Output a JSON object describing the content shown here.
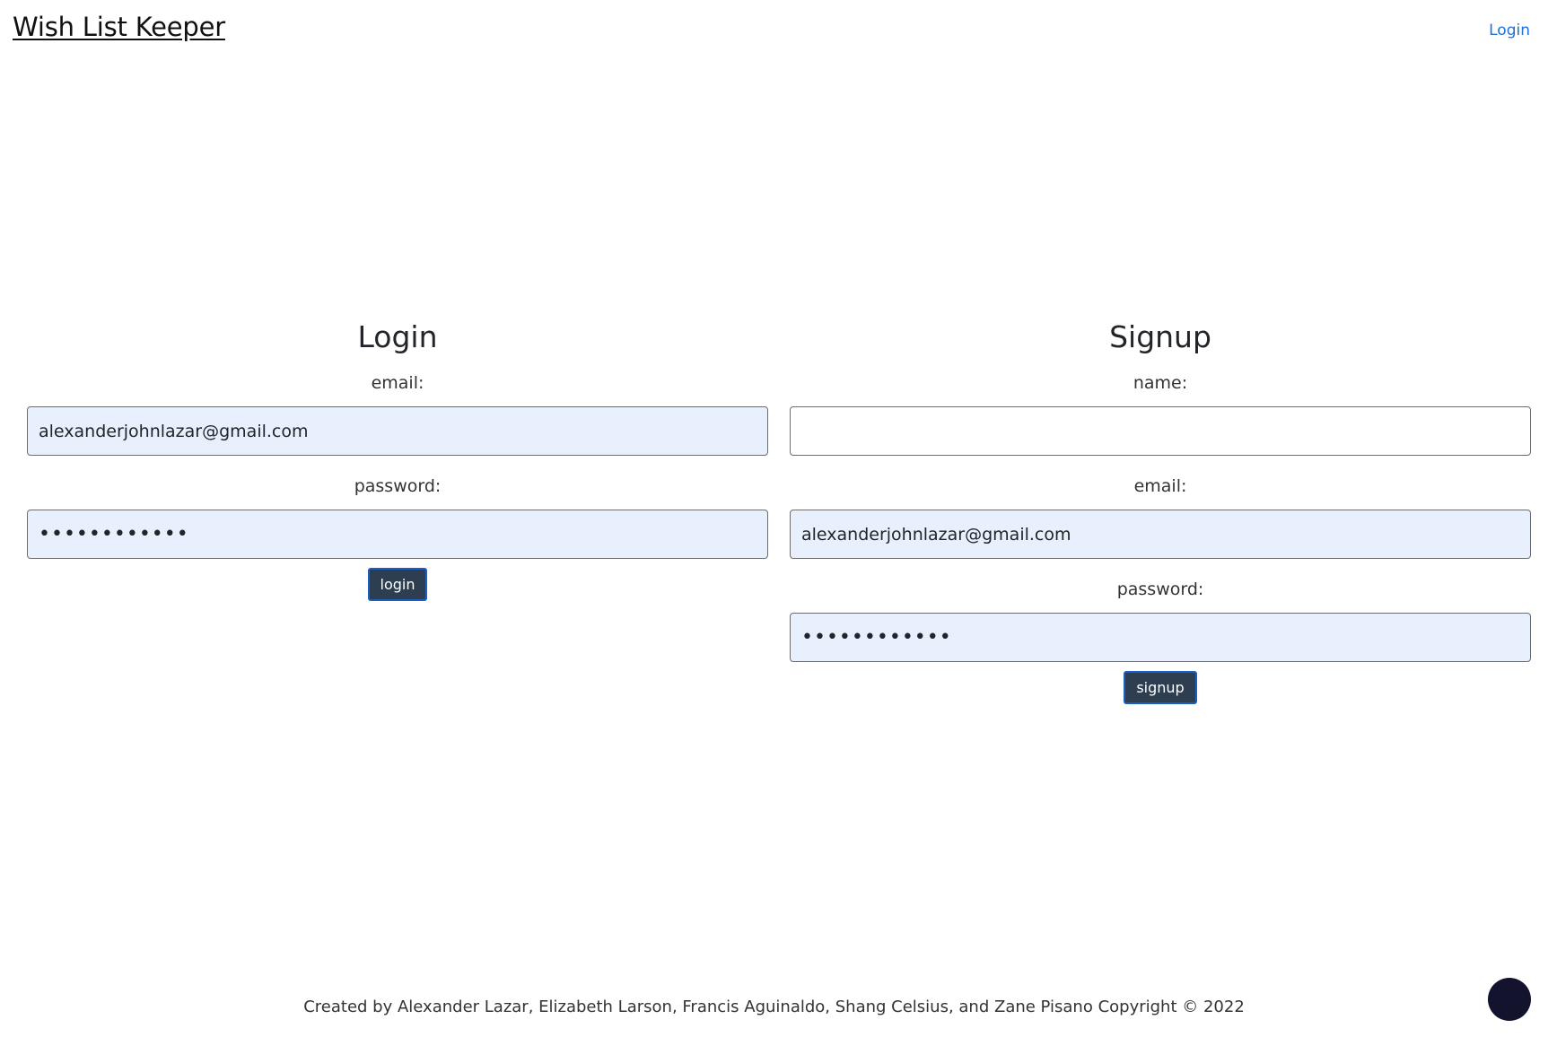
{
  "header": {
    "brand": "Wish List Keeper",
    "nav_login": "Login"
  },
  "login_form": {
    "title": "Login",
    "email_label": "email:",
    "email_value": "alexanderjohnlazar@gmail.com",
    "password_label": "password:",
    "password_value": "••••••••••••",
    "submit_label": "login"
  },
  "signup_form": {
    "title": "Signup",
    "name_label": "name:",
    "name_value": "",
    "email_label": "email:",
    "email_value": "alexanderjohnlazar@gmail.com",
    "password_label": "password:",
    "password_value": "••••••••••••",
    "submit_label": "signup"
  },
  "footer": {
    "text": "Created by Alexander Lazar, Elizabeth Larson, Francis Aguinaldo, Shang Celsius, and Zane Pisano Copyright © 2022"
  },
  "colors": {
    "accent": "#1f6fd6",
    "button_bg": "#2c3e50",
    "autofill_bg": "#e8f0fe",
    "fab_bg": "#14132e"
  }
}
